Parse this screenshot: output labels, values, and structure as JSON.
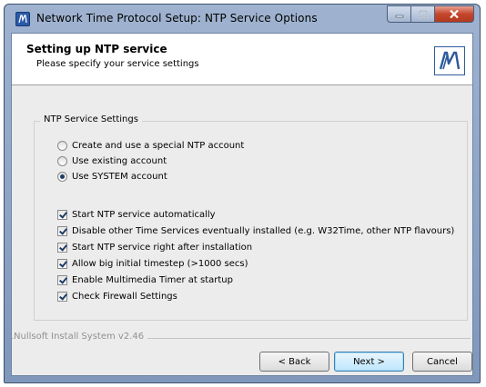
{
  "window": {
    "title": "Network Time Protocol Setup: NTP Service Options"
  },
  "header": {
    "title": "Setting up NTP service",
    "subtitle": "Please specify your service settings"
  },
  "group": {
    "label": "NTP Service Settings"
  },
  "radios": [
    {
      "label": "Create and use a special NTP account",
      "selected": false
    },
    {
      "label": "Use existing account",
      "selected": false
    },
    {
      "label": "Use SYSTEM account",
      "selected": true
    }
  ],
  "checks": [
    {
      "label": "Start NTP service automatically",
      "checked": true
    },
    {
      "label": "Disable other Time Services eventually installed (e.g. W32Time, other NTP flavours)",
      "checked": true
    },
    {
      "label": "Start NTP service right after installation",
      "checked": true
    },
    {
      "label": "Allow big initial timestep (>1000 secs)",
      "checked": true
    },
    {
      "label": "Enable Multimedia Timer at startup",
      "checked": true
    },
    {
      "label": "Check Firewall Settings",
      "checked": true
    }
  ],
  "footer": {
    "branding": "Nullsoft Install System v2.46",
    "back": "< Back",
    "next": "Next >",
    "cancel": "Cancel"
  }
}
